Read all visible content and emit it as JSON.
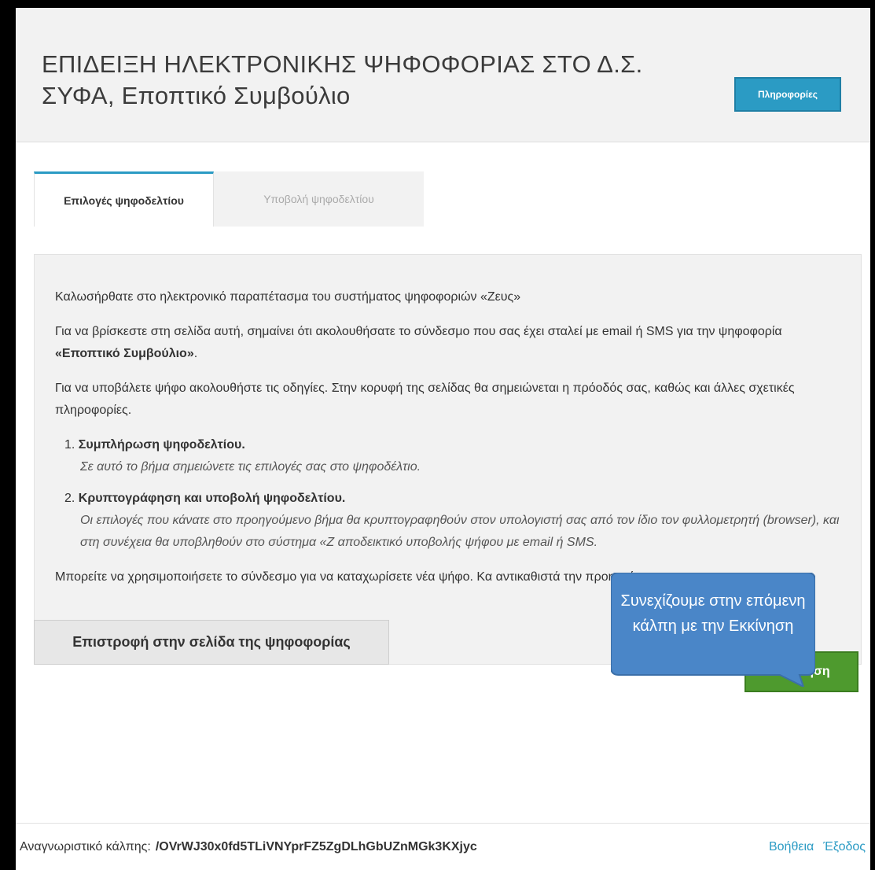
{
  "header": {
    "title_line1": "ΕΠΙΔΕΙΞΗ ΗΛΕΚΤΡΟΝΙΚΗΣ ΨΗΦΟΦΟΡΙΑΣ ΣΤΟ Δ.Σ.",
    "title_line2": "ΣΥΦΑ, Εποπτικό Συμβούλιο",
    "info_button": "Πληροφορίες"
  },
  "tabs": [
    {
      "label": "Επιλογές ψηφοδελτίου",
      "active": true
    },
    {
      "label": "Υποβολή ψηφοδελτίου",
      "active": false
    }
  ],
  "content": {
    "welcome": "Καλωσήρθατε στο ηλεκτρονικό παραπέτασμα του συστήματος ψηφοφοριών «Ζευς»",
    "intro_pre": "Για να βρίσκεστε στη σελίδα αυτή, σημαίνει ότι ακολουθήσατε το σύνδεσμο που σας έχει σταλεί με email ή SMS για την ψηφοφορία ",
    "intro_bold": "«Εποπτικό Συμβούλιο»",
    "intro_post": ".",
    "instructions": "Για να υποβάλετε ψήφο ακολουθήστε τις οδηγίες. Στην κορυφή της σελίδας θα σημειώνεται η πρόοδός σας, καθώς και άλλες σχετικές πληροφορίες.",
    "steps": [
      {
        "number": "1.",
        "title": "Συμπλήρωση ψηφοδελτίου.",
        "description": "Σε αυτό το βήμα σημειώνετε τις επιλογές σας στο ψηφοδέλτιο."
      },
      {
        "number": "2.",
        "title": "Κρυπτογράφηση και υποβολή ψηφοδελτίου.",
        "description": "Οι επιλογές που κάνατε στο προηγούμενο βήμα θα κρυπτογραφηθούν στον υπολογιστή σας από τον ίδιο τον φυλλομετρητή (browser), και στη συνέχεια θα υποβληθούν στο σύστημα «Ζ αποδεικτικό υποβολής ψήφου με email ή SMS."
      }
    ],
    "footer_note": "Μπορείτε να χρησιμοποιήσετε το σύνδεσμο για να καταχωρίσετε νέα ψήφο. Κα αντικαθιστά την προηγούμενη."
  },
  "buttons": {
    "back": "Επιστροφή στην σελίδα της ψηφοφορίας",
    "start": "Εκκίνηση"
  },
  "callout": {
    "text": "Συνεχίζουμε στην επόμενη κάλπη με την Εκκίνηση"
  },
  "footer": {
    "ballot_label": "Αναγνωριστικό κάλπης:",
    "ballot_id": "/OVrWJ30x0fd5TLiVNYprFZ5ZgDLhGbUZnMGk3KXjyc",
    "help_link": "Βοήθεια",
    "logout_link": "Έξοδος"
  },
  "colors": {
    "accent": "#2b9bc4",
    "start_button": "#4e9a2e",
    "callout": "#4a86c8"
  }
}
